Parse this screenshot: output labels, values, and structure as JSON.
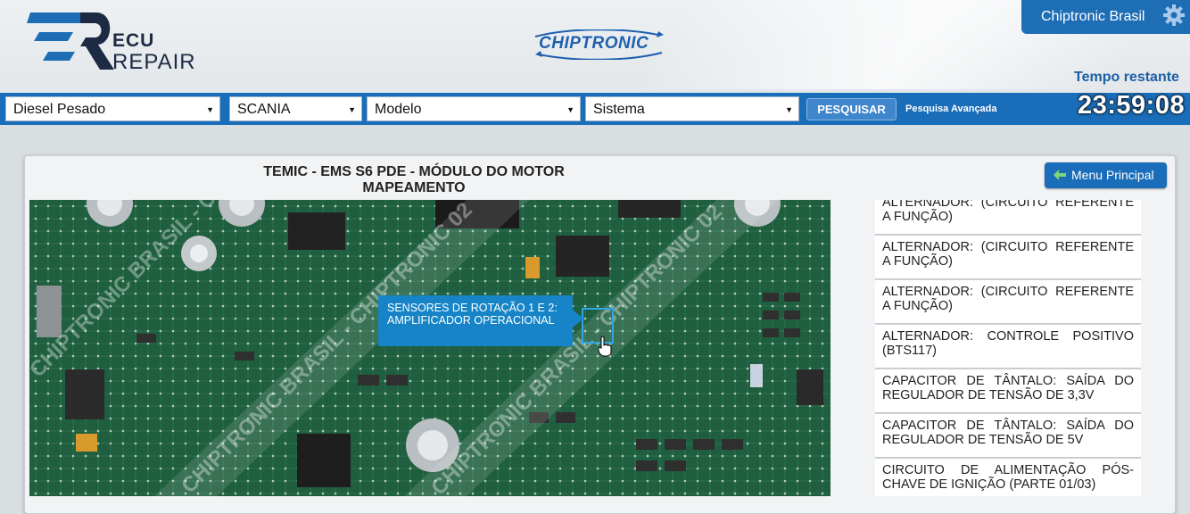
{
  "header": {
    "logo_line1": "ECU",
    "logo_line2": "REPAIR",
    "brand": "CHIPTRONIC",
    "user": "Chiptronic Brasil",
    "time_label": "Tempo restante"
  },
  "search": {
    "vehicle_type": "Diesel Pesado",
    "make": "SCANIA",
    "model": "Modelo",
    "system": "Sistema",
    "search_button": "PESQUISAR",
    "advanced": "Pesquisa Avançada",
    "timer": "23:59:08"
  },
  "panel": {
    "title_line1": "TEMIC - EMS S6 PDE - MÓDULO DO MOTOR",
    "title_line2": "MAPEAMENTO",
    "menu_button": "Menu Principal"
  },
  "board": {
    "tooltip": "SENSORES DE ROTAÇÃO 1 E 2: AMPLIFICADOR OPERACIONAL",
    "watermark": "CHIPTRONIC BRASIL - CHIPTRONIC 02",
    "colors": {
      "pcb": "#1d5a3b",
      "tooltip": "#1684c6"
    }
  },
  "list": [
    "ALTERNADOR: (CIRCUITO REFERENTE A FUNÇÃO)",
    "ALTERNADOR: (CIRCUITO REFERENTE A FUNÇÃO)",
    "ALTERNADOR: (CIRCUITO REFERENTE A FUNÇÃO)",
    "ALTERNADOR: CONTROLE POSITIVO (BTS117)",
    "CAPACITOR DE TÂNTALO: SAÍDA DO REGULADOR DE TENSÃO DE 3,3V",
    "CAPACITOR DE TÂNTALO: SAÍDA DO REGULADOR DE TENSÃO DE 5V",
    "CIRCUITO DE ALIMENTAÇÃO PÓS-CHAVE DE IGNIÇÃO (PARTE 01/03)"
  ],
  "colors": {
    "accent": "#1a6db8",
    "header_bg": "#eef1f3"
  }
}
